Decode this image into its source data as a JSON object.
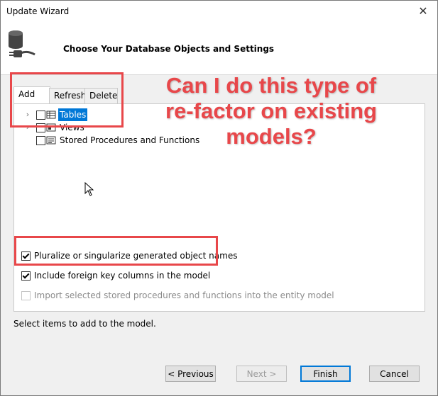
{
  "window": {
    "title": "Update Wizard",
    "close_glyph": "✕"
  },
  "header": {
    "title": "Choose Your Database Objects and Settings",
    "icon": "database-plug-icon"
  },
  "tabs": [
    {
      "label": "Add",
      "active": true
    },
    {
      "label": "Refresh",
      "active": false
    },
    {
      "label": "Delete",
      "active": false
    }
  ],
  "tree": {
    "items": [
      {
        "label": "Tables",
        "expandable": true,
        "selected": true,
        "icon": "table-icon"
      },
      {
        "label": "Views",
        "expandable": true,
        "selected": false,
        "icon": "view-icon"
      },
      {
        "label": "Stored Procedures and Functions",
        "expandable": false,
        "selected": false,
        "icon": "stored-procedure-icon"
      }
    ]
  },
  "options": [
    {
      "label": "Pluralize or singularize generated object names",
      "checked": true,
      "enabled": true
    },
    {
      "label": "Include foreign key columns in the model",
      "checked": true,
      "enabled": true
    },
    {
      "label": "Import selected stored procedures and functions into the entity model",
      "checked": false,
      "enabled": false
    }
  ],
  "status_text": "Select items to add to the model.",
  "buttons": {
    "previous": "< Previous",
    "next": "Next >",
    "finish": "Finish",
    "cancel": "Cancel"
  },
  "annotation": {
    "text": "Can I do this type of re-factor on existing models?",
    "color": "#e8474a"
  },
  "colors": {
    "selection": "#0078d7",
    "annotation": "#e8474a"
  }
}
